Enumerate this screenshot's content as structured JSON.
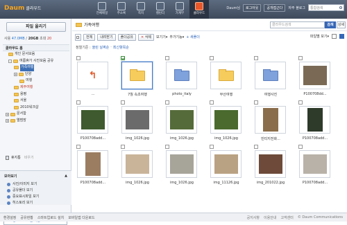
{
  "top": {
    "logo_brand": "Daum",
    "logo_service": "클라우드",
    "apps": [
      {
        "label": "전체메일",
        "icon": "mail-icon"
      },
      {
        "label": "주소록",
        "icon": "address-book-icon"
      },
      {
        "label": "쪽지",
        "icon": "message-icon"
      },
      {
        "label": "캘린더",
        "icon": "calendar-icon"
      },
      {
        "label": "가계부",
        "icon": "household-ledger-icon"
      },
      {
        "label": "클라우드",
        "icon": "cloud-icon"
      }
    ],
    "user": "Daum님",
    "logout": "로그아웃",
    "shared_pc": "공개접근다",
    "fav_label": "자주 블로그",
    "search_placeholder": "통합검색"
  },
  "sidebar": {
    "upload_label": "파일 올리기",
    "usage": {
      "label": "사용",
      "used": "47.0MB",
      "total": "20GB",
      "space_label": "초대",
      "space_value": "20"
    },
    "tree_root": "클라우드 홈",
    "tree": [
      {
        "label": "개인 문서모음",
        "toggle": ""
      },
      {
        "label": "여름휴가 사진모음 공유",
        "toggle": "-"
      },
      {
        "label": "가족여행",
        "toggle": "",
        "selected": true
      },
      {
        "label": "단양",
        "toggle": "+"
      },
      {
        "label": "여행",
        "toggle": ""
      },
      {
        "label": "제주여행",
        "toggle": "",
        "red": true
      },
      {
        "label": "용평",
        "toggle": ""
      },
      {
        "label": "서울",
        "toggle": ""
      },
      {
        "label": "2010워크샵",
        "toggle": ""
      },
      {
        "label": "문서함",
        "toggle": "+"
      },
      {
        "label": "앨범방",
        "toggle": "+"
      }
    ],
    "trash_label": "휴지통",
    "trash_empty": "비우기",
    "moa": {
      "title": "모아보기",
      "collapse": "▲",
      "items": [
        "사진/이미지 보기",
        "공유폴더 보기",
        "중요표시파일 보기",
        "히스토리 보기"
      ]
    },
    "pc_sync": "PC 싱크 프로그램 다운로드"
  },
  "main": {
    "title": "가족여행",
    "search_placeholder": "클라우드검색",
    "search_btn": "검색",
    "detail_btn": "상세",
    "toolbar": {
      "all": "전체",
      "download": "내려받기",
      "share": "폴더공유",
      "delete": "삭제",
      "view_mode": "보기기",
      "add_func": "추가기능",
      "new_folder": "새폴더",
      "file_view": "파일별 보기"
    },
    "sort": {
      "label": "정렬기준 :",
      "by": "올린 날짜순",
      "order": "최신항목순"
    },
    "items": [
      {
        "kind": "up",
        "caption": "...",
        "checked": false
      },
      {
        "kind": "folder",
        "caption": "7월 속초여행",
        "checked": true,
        "selected": true
      },
      {
        "kind": "folder-blue",
        "caption": "photo_italy",
        "checked": false
      },
      {
        "kind": "folder",
        "caption": "부산여행",
        "checked": false
      },
      {
        "kind": "folder-blue",
        "caption": "여행사진",
        "checked": false
      },
      {
        "kind": "photo",
        "caption": "P100708dd...",
        "checked": false,
        "color": "#7a6a55"
      },
      {
        "kind": "photo",
        "caption": "P100708add...",
        "checked": false,
        "color": "#3e5a2e"
      },
      {
        "kind": "photo",
        "caption": "img_1026.jpg",
        "checked": false,
        "color": "#6b6b6b"
      },
      {
        "kind": "photo",
        "caption": "img_1026.jpg",
        "checked": false,
        "color": "#556b3a"
      },
      {
        "kind": "photo",
        "caption": "img_1026.jpg",
        "checked": false,
        "color": "#4a6a2e"
      },
      {
        "kind": "photo-tall",
        "caption": "빈티지전화...",
        "checked": false,
        "color": "#8a6d4a"
      },
      {
        "kind": "photo-tall",
        "caption": "P100708add...",
        "checked": false,
        "color": "#2e3a2a"
      },
      {
        "kind": "photo-tall",
        "caption": "P100708add...",
        "checked": false,
        "color": "#9b7d62"
      },
      {
        "kind": "photo",
        "caption": "img_1026.jpg",
        "checked": false,
        "color": "#c9b49a"
      },
      {
        "kind": "photo",
        "caption": "img_1026.jpg",
        "checked": false,
        "color": "#a7a49a"
      },
      {
        "kind": "photo",
        "caption": "img_11126.jpg",
        "checked": false,
        "color": "#b9a283"
      },
      {
        "kind": "photo",
        "caption": "img_201022.jpg",
        "checked": false,
        "color": "#6d4a3a"
      },
      {
        "kind": "photo",
        "caption": "P100708add...",
        "checked": false,
        "color": "#b8b2a8"
      }
    ]
  },
  "footer": {
    "links": [
      "환경설정",
      "공유현황",
      "스마트업로드 설치",
      "모바일앱 다운로드"
    ],
    "right": [
      "공지사항",
      "이용안내",
      "고객센터",
      "© Daum Communications"
    ]
  }
}
